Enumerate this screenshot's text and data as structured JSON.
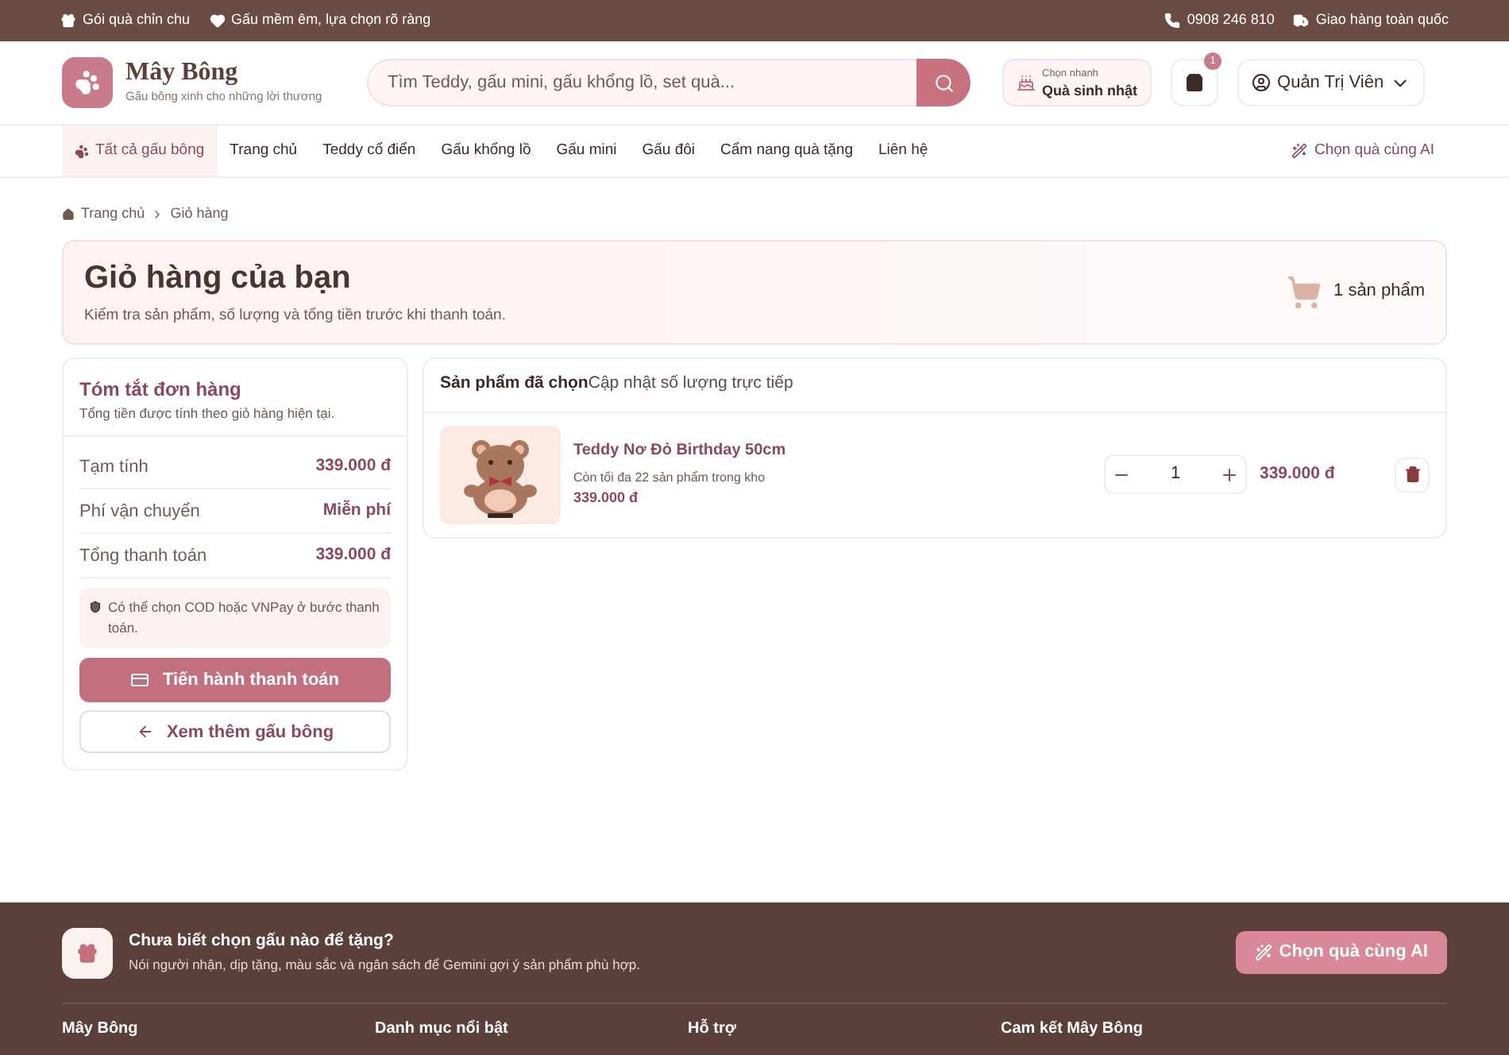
{
  "top_bar": {
    "left": [
      "Gói quà chỉn chu",
      "Gấu mềm êm, lựa chọn rõ ràng"
    ],
    "right": [
      "0908 246 810",
      "Giao hàng toàn quốc"
    ]
  },
  "header": {
    "brand": {
      "name": "Mây Bông",
      "tagline": "Gấu bông xinh cho những lời thương"
    },
    "search": {
      "placeholder": "Tìm Teddy, gấu mini, gấu khổng lồ, set quà..."
    },
    "quick_pick": {
      "label": "Chọn nhanh",
      "value": "Quà sinh nhật"
    },
    "cart_badge": "1",
    "account": "Quản Trị Viên"
  },
  "nav": {
    "items": [
      {
        "label": "Tất cả gấu bông",
        "selected": true
      },
      {
        "label": "Trang chủ",
        "selected": false
      },
      {
        "label": "Teddy cổ điển",
        "selected": false
      },
      {
        "label": "Gấu khổng lồ",
        "selected": false
      },
      {
        "label": "Gấu mini",
        "selected": false
      },
      {
        "label": "Gấu đôi",
        "selected": false
      },
      {
        "label": "Cẩm nang quà tặng",
        "selected": false
      },
      {
        "label": "Liên hệ",
        "selected": false
      }
    ],
    "ai_link": "Chọn quà cùng AI"
  },
  "breadcrumb": [
    "Trang chủ",
    "Giỏ hàng"
  ],
  "cart_header": {
    "title": "Giỏ hàng của bạn",
    "subtitle": "Kiểm tra sản phẩm, số lượng và tổng tiền trước khi thanh toán.",
    "count": "1 sản phẩm"
  },
  "summary": {
    "title": "Tóm tắt đơn hàng",
    "subtitle": "Tổng tiền được tính theo giỏ hàng hiện tại.",
    "rows": [
      {
        "label": "Tạm tính",
        "value": "339.000 đ"
      },
      {
        "label": "Phí vận chuyển",
        "value": "Miễn phí"
      },
      {
        "label": "Tổng thanh toán",
        "value": "339.000 đ"
      }
    ],
    "note": "Có thể chọn COD hoặc VNPay ở bước thanh toán.",
    "checkout_button": "Tiến hành thanh toán",
    "continue_button": "Xem thêm gấu bông"
  },
  "items_panel": {
    "title": "Sản phẩm đã chọn",
    "subtitle": "Cập nhật số lượng trực tiếp",
    "items": [
      {
        "name": "Teddy Nơ Đỏ Birthday 50cm",
        "stock": "Còn tối đa 22 sản phẩm trong kho",
        "price": "339.000 đ",
        "quantity": "1",
        "line_total": "339.000 đ"
      }
    ]
  },
  "footer": {
    "promo": {
      "title": "Chưa biết chọn gấu nào để tặng?",
      "text": "Nói người nhận, dịp tặng, màu sắc và ngân sách để Gemini gợi ý sản phẩm phù hợp.",
      "button": "Chọn quà cùng AI"
    },
    "columns": [
      "Mây Bông",
      "Danh mục nổi bật",
      "Hỗ trợ",
      "Cam kết Mây Bông"
    ]
  }
}
